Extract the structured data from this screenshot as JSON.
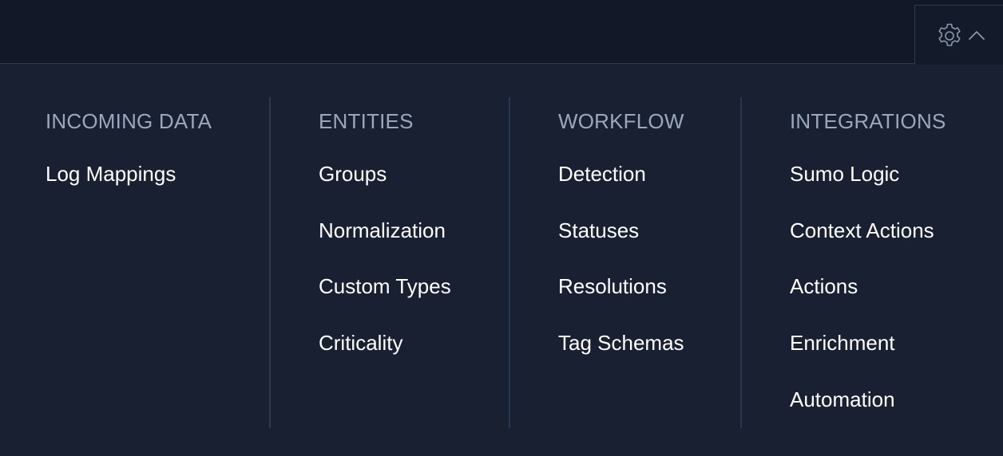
{
  "header": {
    "settings_icon": "gear-icon",
    "toggle_icon": "chevron-up-icon"
  },
  "menu": {
    "columns": [
      {
        "heading": "INCOMING DATA",
        "items": [
          "Log Mappings"
        ]
      },
      {
        "heading": "ENTITIES",
        "items": [
          "Groups",
          "Normalization",
          "Custom Types",
          "Criticality"
        ]
      },
      {
        "heading": "WORKFLOW",
        "items": [
          "Detection",
          "Statuses",
          "Resolutions",
          "Tag Schemas"
        ]
      },
      {
        "heading": "INTEGRATIONS",
        "items": [
          "Sumo Logic",
          "Context Actions",
          "Actions",
          "Enrichment",
          "Automation"
        ]
      }
    ]
  },
  "colors": {
    "background": "#182032",
    "topbar": "#121827",
    "heading": "#9aa8be",
    "item": "#ffffff",
    "divider": "#2a3750"
  }
}
